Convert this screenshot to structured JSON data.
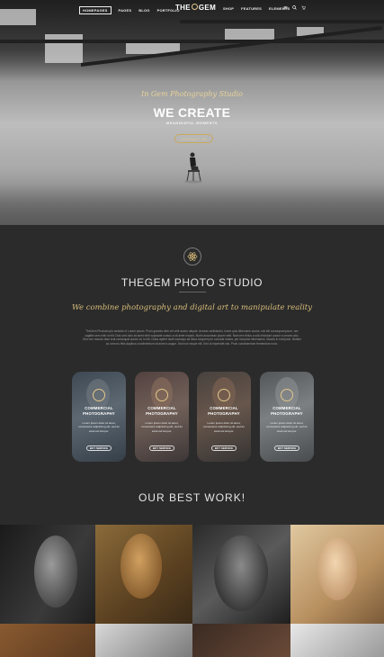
{
  "nav": {
    "left": [
      "HOMEPAGES",
      "PAGES",
      "BLOG",
      "PORTFOLIO"
    ],
    "active": "HOMEPAGES",
    "logo_pre": "THE",
    "logo_post": "GEM",
    "right": [
      "SHOP",
      "FEATURES",
      "ELEMENTS"
    ],
    "icons": [
      "menu-icon",
      "search-icon",
      "cart-icon"
    ]
  },
  "hero": {
    "script": "In Gem Photography Studio",
    "title": "WE CREATE",
    "subtitle": "MEANINGFUL MOMENTS",
    "button": "CONTACT US"
  },
  "intro": {
    "title": "THEGEM PHOTO STUDIO",
    "tagline": "We combine photography and digital art to manipulate reality",
    "paragraph": "TheGem Photoshop's website of Lorem ipsum. Proin gravida nibh vel velit auctor aliquet. Aenean sollicitudin, lorem quis bibendum auctor, nisi elit consequat ipsum, nec sagittis sem nibh id elit. Duis sed odio sit amet nibh vulputate cursus a sit amet mauris. Morbi accumsan ipsum velit. Nam nec tellus a odio tincidunt auctor a ornare odio. Sed non mauris vitae erat consequat auctor eu in elit. Class aptent taciti sociosqu ad litora torquent per conubia nostra, per inceptos himenaeos. Mauris in erat justo. Nullam ac urna eu felis dapibus condimentum sit amet a augue. Sed non neque elit. Sed ut imperdiet nisi. Proin condimentum fermentum nunc."
  },
  "cards": [
    {
      "title": "COMMERCIAL PHOTOGRAPHY",
      "text": "Lorem ipsum dolor sit amet, consectetur adipisicing elit, sed do eiusmod tempor.",
      "button": "BUY SERVICE",
      "bg": "#4a5560"
    },
    {
      "title": "COMMERCIAL PHOTOGRAPHY",
      "text": "Lorem ipsum dolor sit amet, consectetur adipisicing elit, sed do eiusmod tempor.",
      "button": "BUY SERVICE",
      "bg": "#5a4a48"
    },
    {
      "title": "COMMERCIAL PHOTOGRAPHY",
      "text": "Lorem ipsum dolor sit amet, consectetur adipisicing elit, sed do eiusmod tempor.",
      "button": "BUY SERVICE",
      "bg": "#4e4844"
    },
    {
      "title": "COMMERCIAL PHOTOGRAPHY",
      "text": "Lorem ipsum dolor sit amet, consectetur adipisicing elit, sed do eiusmod tempor.",
      "button": "BUY SERVICE",
      "bg": "#6a6a6a"
    }
  ],
  "best_title": "OUR BEST WORK!",
  "colors": {
    "background": "#2b2b2b",
    "accent_gold": "#d8bd7a"
  }
}
